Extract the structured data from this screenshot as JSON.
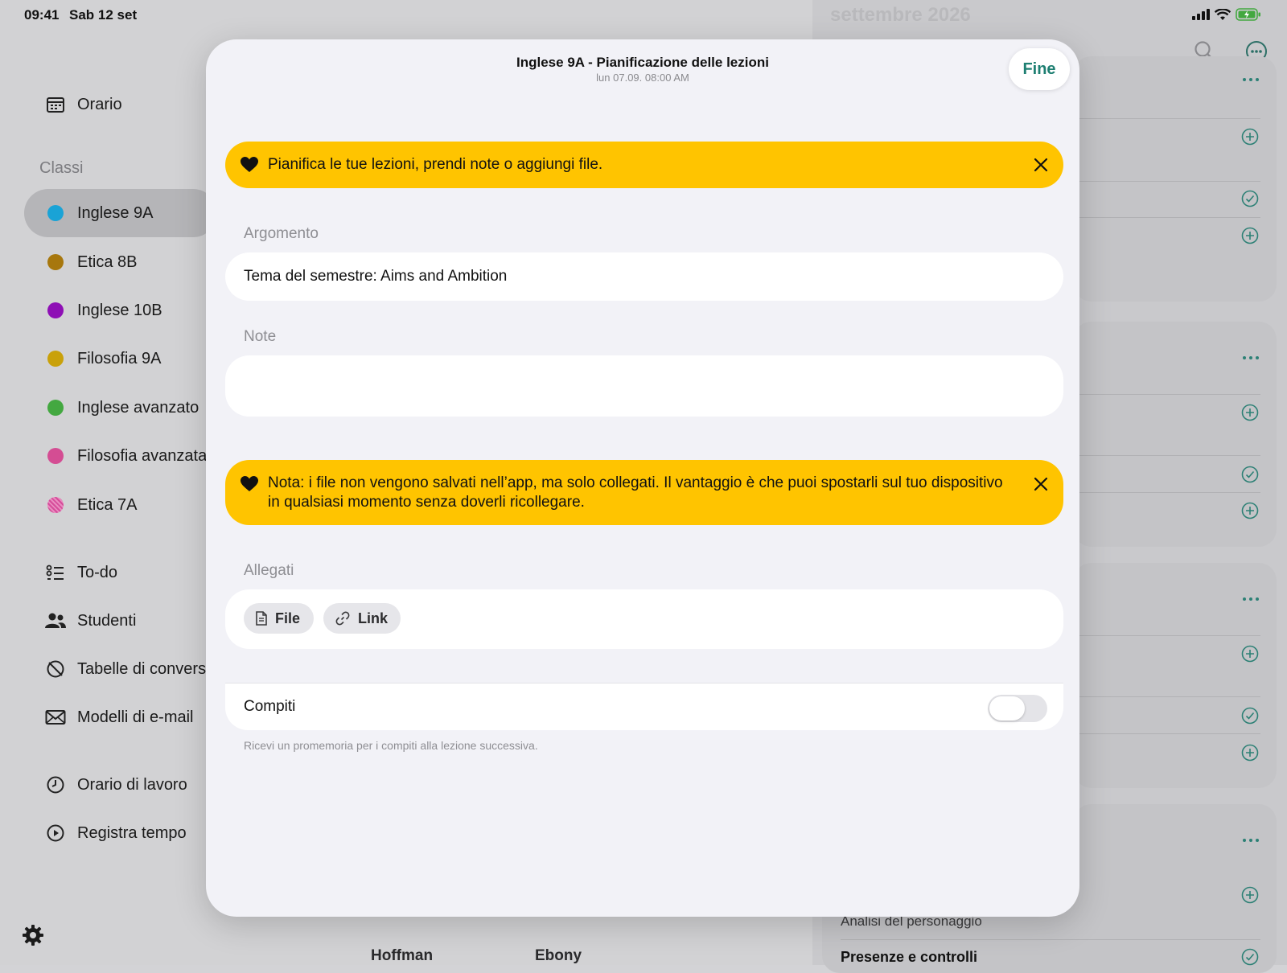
{
  "status_bar": {
    "time": "09:41",
    "date": "Sab 12 set"
  },
  "sidebar": {
    "top_items": [
      {
        "label": "Orario",
        "icon": "calendar-icon"
      }
    ],
    "classes_title": "Classi",
    "classes": [
      {
        "label": "Inglese 9A",
        "color": "#1aa3d6"
      },
      {
        "label": "Etica 8B",
        "color": "#a7770d"
      },
      {
        "label": "Inglese 10B",
        "color": "#8e0fb5"
      },
      {
        "label": "Filosofia 9A",
        "color": "#c9a10a"
      },
      {
        "label": "Inglese avanzato",
        "color": "#43a840"
      },
      {
        "label": "Filosofia avanzata",
        "color": "#d44d93"
      },
      {
        "label": "Etica 7A",
        "color": "#d64d9a"
      }
    ],
    "tools": [
      {
        "label": "To-do",
        "icon": "checklist-icon"
      },
      {
        "label": "Studenti",
        "icon": "people-icon"
      },
      {
        "label": "Tabelle di conversi",
        "icon": "no-scale-icon"
      },
      {
        "label": "Modelli di e-mail",
        "icon": "envelope-icon"
      }
    ],
    "work": [
      {
        "label": "Orario di lavoro",
        "icon": "clock-icon"
      },
      {
        "label": "Registra tempo",
        "icon": "play-icon"
      }
    ]
  },
  "right_pane": {
    "header": "settembre 2026",
    "texts": [
      "Analisi del personaggio",
      "Presenze e controlli"
    ],
    "bottom_names": [
      "Hoffman",
      "Ebony"
    ]
  },
  "modal": {
    "title": "Inglese 9A - Pianificazione delle lezioni",
    "subtitle": "lun 07.09. 08:00 AM",
    "done_label": "Fine",
    "banner1": "Pianifica le tue lezioni, prendi note o aggiungi file.",
    "topic_label": "Argomento",
    "topic_value": "Tema del semestre: Aims and Ambition",
    "notes_label": "Note",
    "notes_value": "",
    "banner2": "Nota: i file non vengono salvati nell’app, ma solo collegati. Il vantaggio è che puoi spostarli sul tuo dispositivo in qualsiasi momento senza doverli ricollegare.",
    "attachments_label": "Allegati",
    "file_label": "File",
    "link_label": "Link",
    "homework_label": "Compiti",
    "homework_enabled": false,
    "homework_footnote": "Ricevi un promemoria per i compiti alla lezione successiva."
  },
  "colors": {
    "accent": "#1e7f72",
    "banner": "#ffc400"
  }
}
